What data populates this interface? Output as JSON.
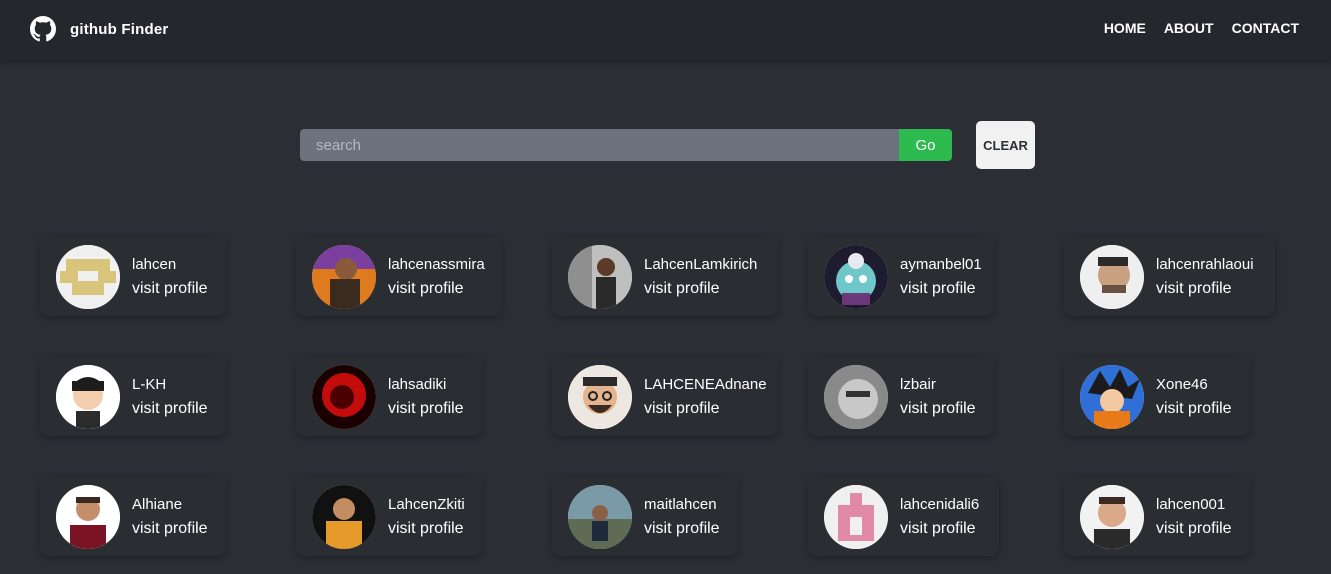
{
  "nav": {
    "brand": "github Finder",
    "links": [
      "HOME",
      "ABOUT",
      "CONTACT"
    ]
  },
  "search": {
    "placeholder": "search",
    "value": "",
    "go_label": "Go",
    "clear_label": "CLEAR"
  },
  "users": [
    {
      "login": "lahcen",
      "link_label": "visit profile",
      "avatar": "identicon-yellow"
    },
    {
      "login": "lahcenassmira",
      "link_label": "visit profile",
      "avatar": "photo"
    },
    {
      "login": "LahcenLamkirich",
      "link_label": "visit profile",
      "avatar": "photo"
    },
    {
      "login": "aymanbel01",
      "link_label": "visit profile",
      "avatar": "photo"
    },
    {
      "login": "lahcenrahlaoui",
      "link_label": "visit profile",
      "avatar": "photo"
    },
    {
      "login": "L-KH",
      "link_label": "visit profile",
      "avatar": "cartoon"
    },
    {
      "login": "lahsadiki",
      "link_label": "visit profile",
      "avatar": "photo"
    },
    {
      "login": "LAHCENEAdnane",
      "link_label": "visit profile",
      "avatar": "cartoon"
    },
    {
      "login": "lzbair",
      "link_label": "visit profile",
      "avatar": "photo"
    },
    {
      "login": "Xone46",
      "link_label": "visit profile",
      "avatar": "photo"
    },
    {
      "login": "Alhiane",
      "link_label": "visit profile",
      "avatar": "photo"
    },
    {
      "login": "LahcenZkiti",
      "link_label": "visit profile",
      "avatar": "photo"
    },
    {
      "login": "maitlahcen",
      "link_label": "visit profile",
      "avatar": "photo"
    },
    {
      "login": "lahcenidali6",
      "link_label": "visit profile",
      "avatar": "identicon-pink"
    },
    {
      "login": "lahcen001",
      "link_label": "visit profile",
      "avatar": "photo"
    }
  ],
  "colors": {
    "background": "#2b2e34",
    "navbar": "#24272b",
    "card": "#2a2d32",
    "search": "#6c737f",
    "go": "#2dba4e",
    "clear": "#f1f1f2"
  }
}
